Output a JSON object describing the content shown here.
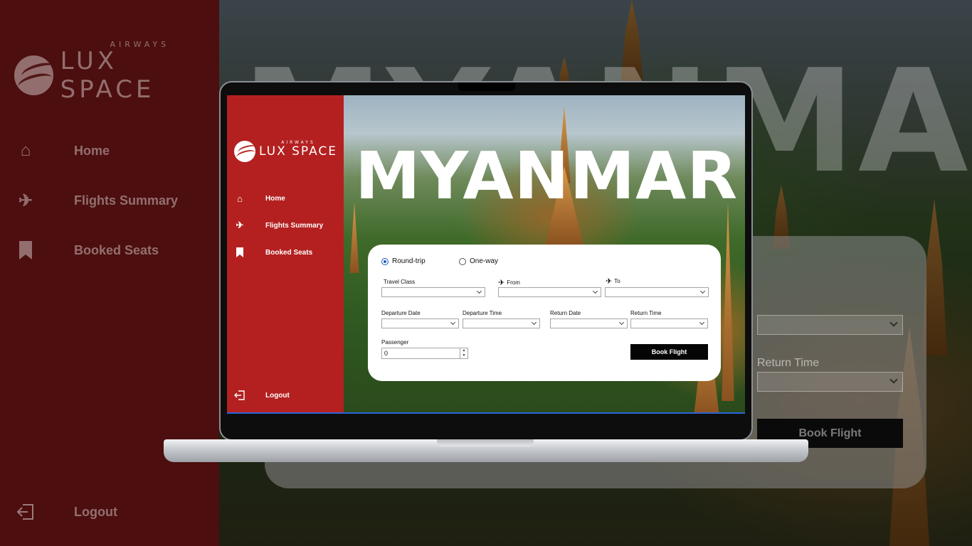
{
  "brand": {
    "name": "LUX SPACE",
    "sub": "AIRWAYS"
  },
  "hero_title": "MYANMAR",
  "nav": {
    "items": [
      {
        "label": "Home",
        "icon": "home-icon"
      },
      {
        "label": "Flights Summary",
        "icon": "airplane-icon"
      },
      {
        "label": "Booked Seats",
        "icon": "bookmark-icon"
      }
    ],
    "logout": {
      "label": "Logout",
      "icon": "logout-icon"
    }
  },
  "form": {
    "trip_types": [
      {
        "label": "Round-trip",
        "selected": true
      },
      {
        "label": "One-way",
        "selected": false
      }
    ],
    "travel_class_label": "Travel Class",
    "from_label": "From",
    "to_label": "To",
    "departure_date_label": "Departure Date",
    "departure_time_label": "Departure Time",
    "return_date_label": "Return Date",
    "return_time_label": "Return Time",
    "passenger_label": "Passenger",
    "passenger_value": "0",
    "book_label": "Book Flight"
  },
  "colors": {
    "sidebar": "#b42020",
    "sidebar_dim": "#4c0e0e",
    "button": "#050505",
    "radio_accent": "#1a5bc4"
  }
}
